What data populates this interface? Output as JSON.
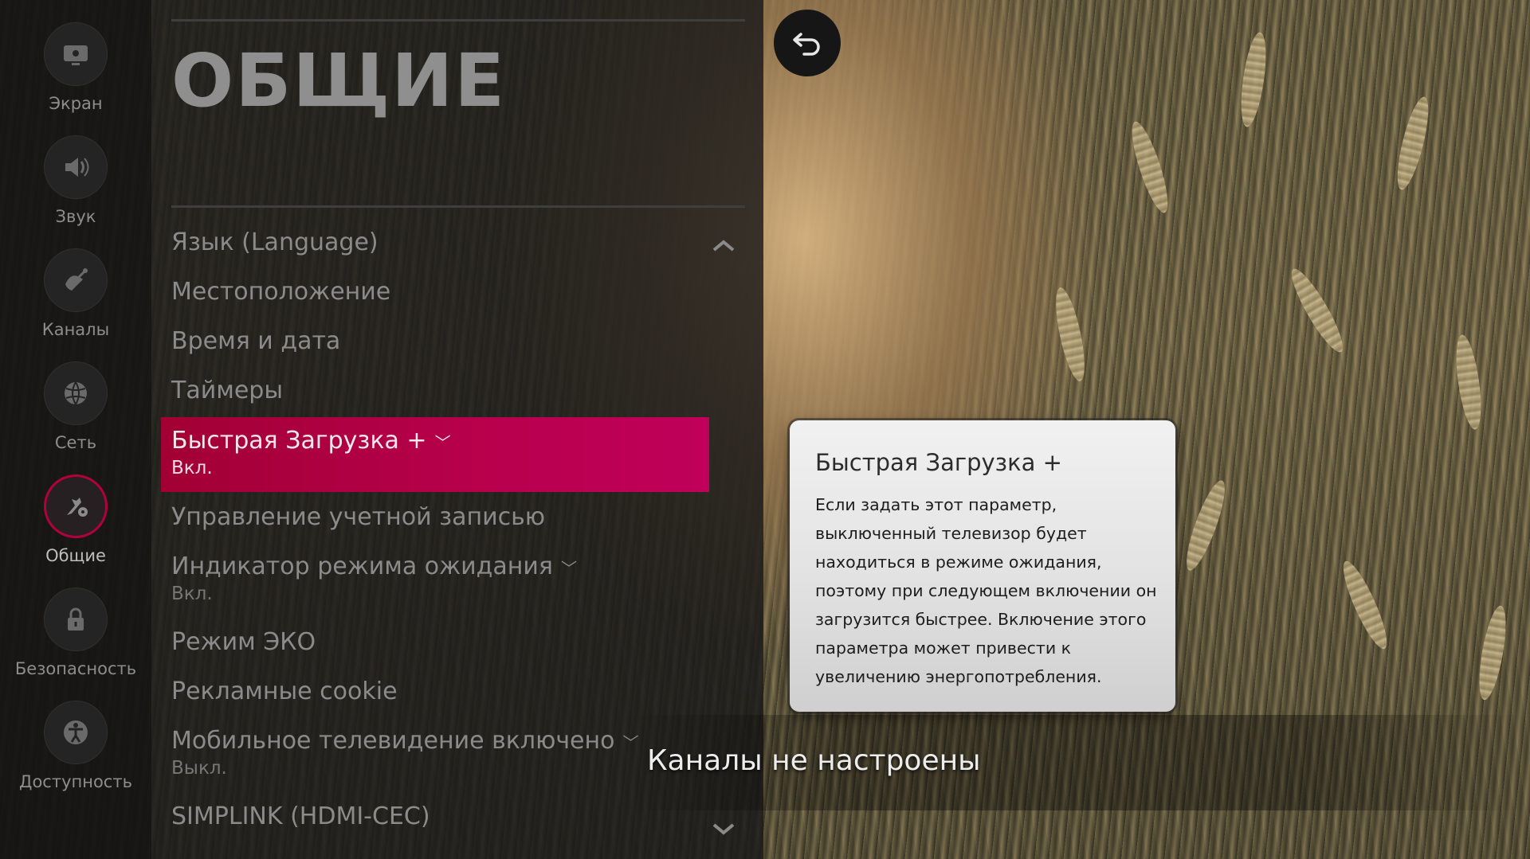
{
  "rail": {
    "items": [
      {
        "label": "Экран",
        "icon": "screen-icon",
        "active": false
      },
      {
        "label": "Звук",
        "icon": "sound-icon",
        "active": false
      },
      {
        "label": "Каналы",
        "icon": "channels-icon",
        "active": false
      },
      {
        "label": "Сеть",
        "icon": "network-icon",
        "active": false
      },
      {
        "label": "Общие",
        "icon": "general-settings-icon",
        "active": true
      },
      {
        "label": "Безопасность",
        "icon": "lock-icon",
        "active": false
      },
      {
        "label": "Доступность",
        "icon": "accessibility-icon",
        "active": false
      }
    ]
  },
  "menu": {
    "title": "ОБЩИЕ",
    "items": [
      {
        "label": "Язык (Language)"
      },
      {
        "label": "Местоположение"
      },
      {
        "label": "Время и дата"
      },
      {
        "label": "Таймеры"
      },
      {
        "label": "Быстрая Загрузка +",
        "value": "Вкл."
      },
      {
        "label": "Управление учетной записью"
      },
      {
        "label": "Индикатор режима ожидания",
        "value": "Вкл."
      },
      {
        "label": "Режим ЭКО"
      },
      {
        "label": "Рекламные cookie"
      },
      {
        "label": "Мобильное телевидение включено",
        "value": "Выкл."
      },
      {
        "label": "SIMPLINK (HDMI-CEC)"
      }
    ]
  },
  "tooltip": {
    "title": "Быстрая Загрузка +",
    "body": "Если задать этот параметр, выключенный телевизор будет находиться в режиме ожидания, поэтому при следующем включении он загрузится быстрее. Включение этого параметра может привести к увеличению энергопотребления."
  },
  "banner": {
    "text": "Каналы не настроены"
  },
  "colors": {
    "accent": "#b8004d",
    "panel": "#181818",
    "text_dim": "#8b8b8b"
  },
  "icons": {
    "back": "back-arrow-icon",
    "scroll_up": "chevron-up-icon",
    "scroll_down": "chevron-down-icon"
  }
}
